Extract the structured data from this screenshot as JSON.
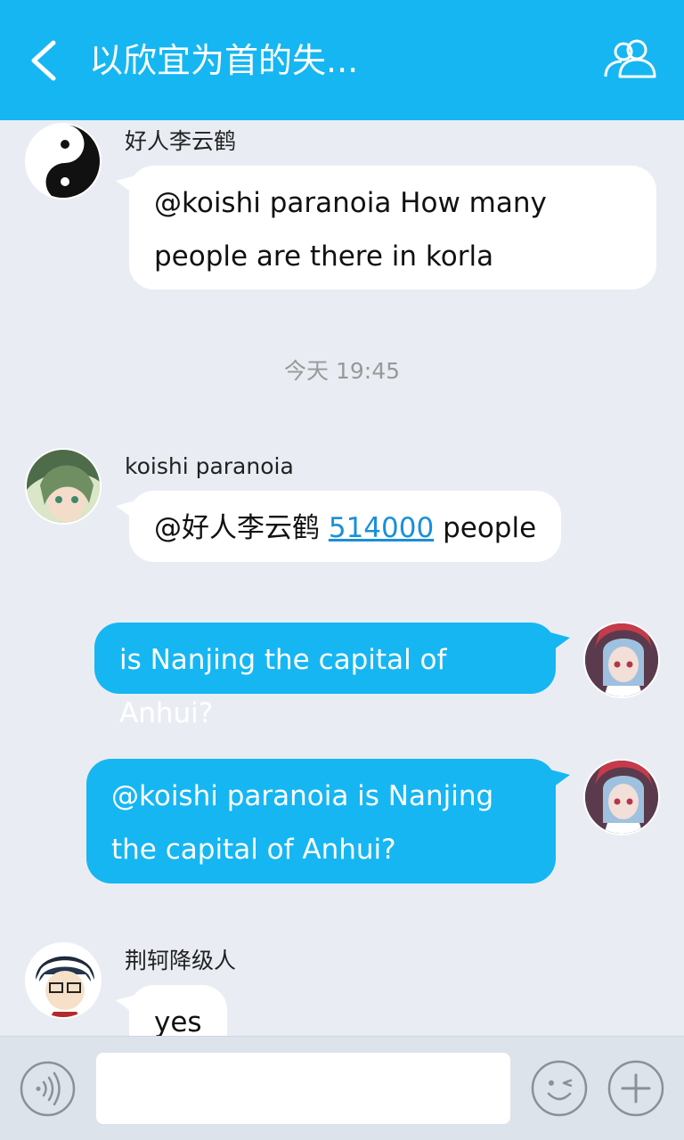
{
  "header": {
    "title": "以欣宜为首的失...",
    "back_icon": "chevron-left-icon",
    "group_icon": "group-members-icon"
  },
  "messages": [
    {
      "sender": "好人李云鹤",
      "text": "@koishi paranoia How many people are there in korla",
      "direction": "incoming"
    },
    {
      "sender": "koishi paranoia",
      "mention": "@好人李云鹤",
      "link": "514000",
      "suffix": "people",
      "direction": "incoming"
    },
    {
      "text": "is Nanjing the capital of Anhui?",
      "direction": "outgoing"
    },
    {
      "text": "@koishi paranoia is Nanjing the capital of Anhui?",
      "direction": "outgoing"
    },
    {
      "sender": "荆轲降级人",
      "text": "yes",
      "direction": "incoming"
    }
  ],
  "timestamp": {
    "day": "今天",
    "time": "19:45"
  },
  "footer": {
    "input_value": "",
    "voice_icon": "voice-icon",
    "emoji_icon": "emoji-icon",
    "plus_icon": "plus-icon"
  },
  "colors": {
    "accent": "#16b6f2",
    "background": "#e9edf3",
    "link": "#1a8fd8"
  }
}
